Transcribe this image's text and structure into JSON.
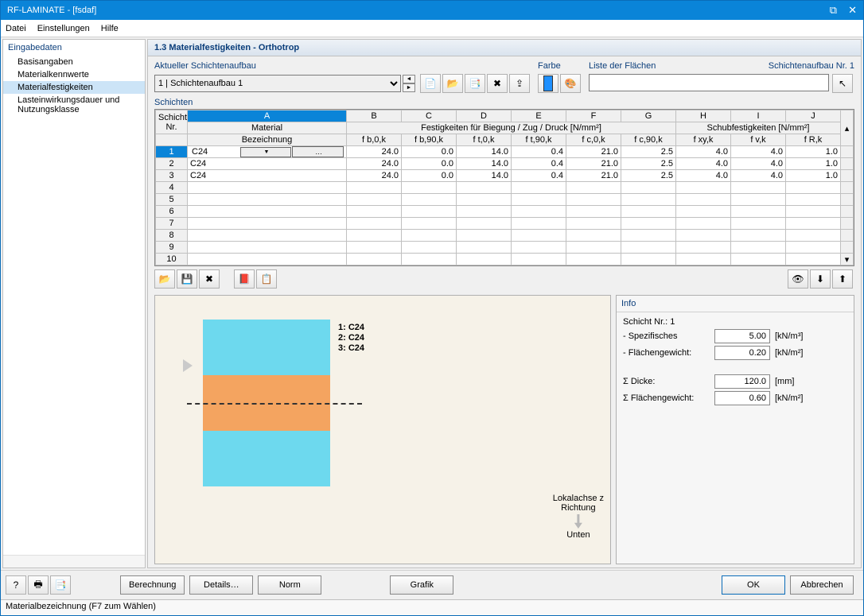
{
  "window": {
    "title": "RF-LAMINATE - [fsdaf]"
  },
  "menu": {
    "file": "Datei",
    "settings": "Einstellungen",
    "help": "Hilfe"
  },
  "sidebar": {
    "root": "Eingabedaten",
    "items": [
      "Basisangaben",
      "Materialkennwerte",
      "Materialfestigkeiten",
      "Lasteinwirkungsdauer und Nutzungsklasse"
    ],
    "selected_index": 2
  },
  "panel_title": "1.3 Materialfestigkeiten - Orthotrop",
  "toolbar": {
    "layup_label": "Aktueller Schichtenaufbau",
    "layup_value": "1 | Schichtenaufbau 1",
    "color_label": "Farbe",
    "surfaces_label": "Liste der Flächen",
    "nr_label": "Schichtenaufbau Nr. 1",
    "surfaces_value": ""
  },
  "table": {
    "section": "Schichten",
    "header1": {
      "schicht": "Schicht",
      "mat": "Material",
      "fest": "Festigkeiten für Biegung / Zug / Druck [N/mm²]",
      "schub": "Schubfestigkeiten [N/mm²]"
    },
    "cols": {
      "A": "A",
      "B": "B",
      "C": "C",
      "D": "D",
      "E": "E",
      "F": "F",
      "G": "G",
      "H": "H",
      "I": "I",
      "J": "J"
    },
    "header2": {
      "nr": "Nr.",
      "bez": "Bezeichnung",
      "fb0k": "f b,0,k",
      "fb90k": "f b,90,k",
      "ft0k": "f t,0,k",
      "ft90k": "f t,90,k",
      "fc0k": "f c,0,k",
      "fc90k": "f c,90,k",
      "fxyk": "f xy,k",
      "fvk": "f v,k",
      "fRk": "f R,k"
    },
    "rows": [
      {
        "nr": "1",
        "mat": "C24",
        "editing": true,
        "v": [
          "24.0",
          "0.0",
          "14.0",
          "0.4",
          "21.0",
          "2.5",
          "4.0",
          "4.0",
          "1.0"
        ]
      },
      {
        "nr": "2",
        "mat": "C24",
        "editing": false,
        "v": [
          "24.0",
          "0.0",
          "14.0",
          "0.4",
          "21.0",
          "2.5",
          "4.0",
          "4.0",
          "1.0"
        ]
      },
      {
        "nr": "3",
        "mat": "C24",
        "editing": false,
        "v": [
          "24.0",
          "0.0",
          "14.0",
          "0.4",
          "21.0",
          "2.5",
          "4.0",
          "4.0",
          "1.0"
        ]
      },
      {
        "nr": "4",
        "mat": "",
        "editing": false,
        "v": [
          "",
          "",
          "",
          "",
          "",
          "",
          "",
          "",
          ""
        ]
      },
      {
        "nr": "5",
        "mat": "",
        "editing": false,
        "v": [
          "",
          "",
          "",
          "",
          "",
          "",
          "",
          "",
          ""
        ]
      },
      {
        "nr": "6",
        "mat": "",
        "editing": false,
        "v": [
          "",
          "",
          "",
          "",
          "",
          "",
          "",
          "",
          ""
        ]
      },
      {
        "nr": "7",
        "mat": "",
        "editing": false,
        "v": [
          "",
          "",
          "",
          "",
          "",
          "",
          "",
          "",
          ""
        ]
      },
      {
        "nr": "8",
        "mat": "",
        "editing": false,
        "v": [
          "",
          "",
          "",
          "",
          "",
          "",
          "",
          "",
          ""
        ]
      },
      {
        "nr": "9",
        "mat": "",
        "editing": false,
        "v": [
          "",
          "",
          "",
          "",
          "",
          "",
          "",
          "",
          ""
        ]
      },
      {
        "nr": "10",
        "mat": "",
        "editing": false,
        "v": [
          "",
          "",
          "",
          "",
          "",
          "",
          "",
          "",
          ""
        ]
      }
    ]
  },
  "preview": {
    "labels": [
      "1: C24",
      "2: C24",
      "3: C24"
    ],
    "axis1": "Lokalachse z",
    "axis2": "Richtung",
    "axis3": "Unten"
  },
  "info": {
    "title": "Info",
    "schicht_nr": "Schicht Nr.: 1",
    "spez_label": "- Spezifisches",
    "spez_val": "5.00",
    "spez_unit": "[kN/m³]",
    "flg_label": "- Flächengewicht:",
    "flg_val": "0.20",
    "flg_unit": "[kN/m²]",
    "dicke_label": "Σ Dicke:",
    "dicke_val": "120.0",
    "dicke_unit": "[mm]",
    "sflg_label": "Σ Flächengewicht:",
    "sflg_val": "0.60",
    "sflg_unit": "[kN/m²]"
  },
  "buttons": {
    "calc": "Berechnung",
    "details": "Details…",
    "norm": "Norm",
    "grafik": "Grafik",
    "ok": "OK",
    "cancel": "Abbrechen"
  },
  "status": "Materialbezeichnung (F7 zum Wählen)"
}
